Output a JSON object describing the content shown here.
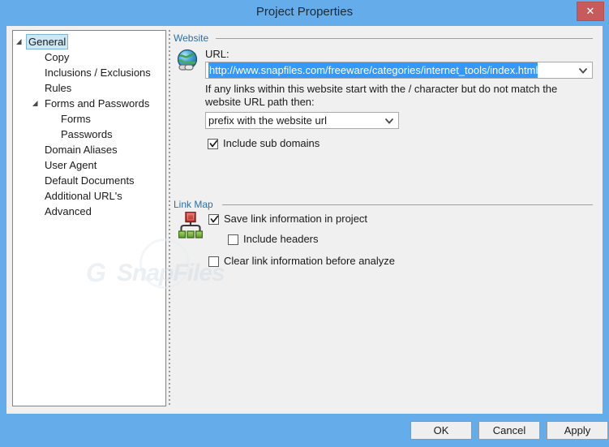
{
  "window": {
    "title": "Project Properties",
    "close_label": "✕",
    "accent_color": "#65aceb",
    "client_bg": "#f0f0f0"
  },
  "tree": {
    "items": [
      {
        "label": "General",
        "depth": 0,
        "expander": "collapse-arrow",
        "selected": true
      },
      {
        "label": "Copy",
        "depth": 1,
        "expander": "",
        "selected": false
      },
      {
        "label": "Inclusions / Exclusions",
        "depth": 1,
        "expander": "",
        "selected": false
      },
      {
        "label": "Rules",
        "depth": 1,
        "expander": "",
        "selected": false
      },
      {
        "label": "Forms and Passwords",
        "depth": 1,
        "expander": "collapse-arrow",
        "selected": false
      },
      {
        "label": "Forms",
        "depth": 2,
        "expander": "",
        "selected": false
      },
      {
        "label": "Passwords",
        "depth": 2,
        "expander": "",
        "selected": false
      },
      {
        "label": "Domain Aliases",
        "depth": 1,
        "expander": "",
        "selected": false
      },
      {
        "label": "User Agent",
        "depth": 1,
        "expander": "",
        "selected": false
      },
      {
        "label": "Default Documents",
        "depth": 1,
        "expander": "",
        "selected": false
      },
      {
        "label": "Additional URL's",
        "depth": 1,
        "expander": "",
        "selected": false
      },
      {
        "label": "Advanced",
        "depth": 1,
        "expander": "",
        "selected": false
      }
    ]
  },
  "website_group": {
    "caption": "Website",
    "icon": "globe-link-icon",
    "url_label": "URL:",
    "url_value": "http://www.snapfiles.com/freeware/categories/internet_tools/index.html",
    "url_placeholder": "",
    "url_selected": true,
    "hint_text": "If any links within this website start with the / character but do not match the website URL path then:",
    "prefix_select_value": "prefix with the website url",
    "prefix_select_options": [
      "prefix with the website url"
    ],
    "include_sub_domains": {
      "label": "Include sub domains",
      "checked": true
    }
  },
  "linkmap_group": {
    "caption": "Link Map",
    "icon": "sitemap-icon",
    "save_link_info": {
      "label": "Save link information in project",
      "checked": true
    },
    "include_headers": {
      "label": "Include headers",
      "checked": false
    },
    "clear_link_info": {
      "label": "Clear link information before analyze",
      "checked": false
    }
  },
  "watermark": {
    "prefix": "G",
    "text": "SnapFiles"
  },
  "footer": {
    "ok_label": "OK",
    "cancel_label": "Cancel",
    "apply_label": "Apply"
  }
}
